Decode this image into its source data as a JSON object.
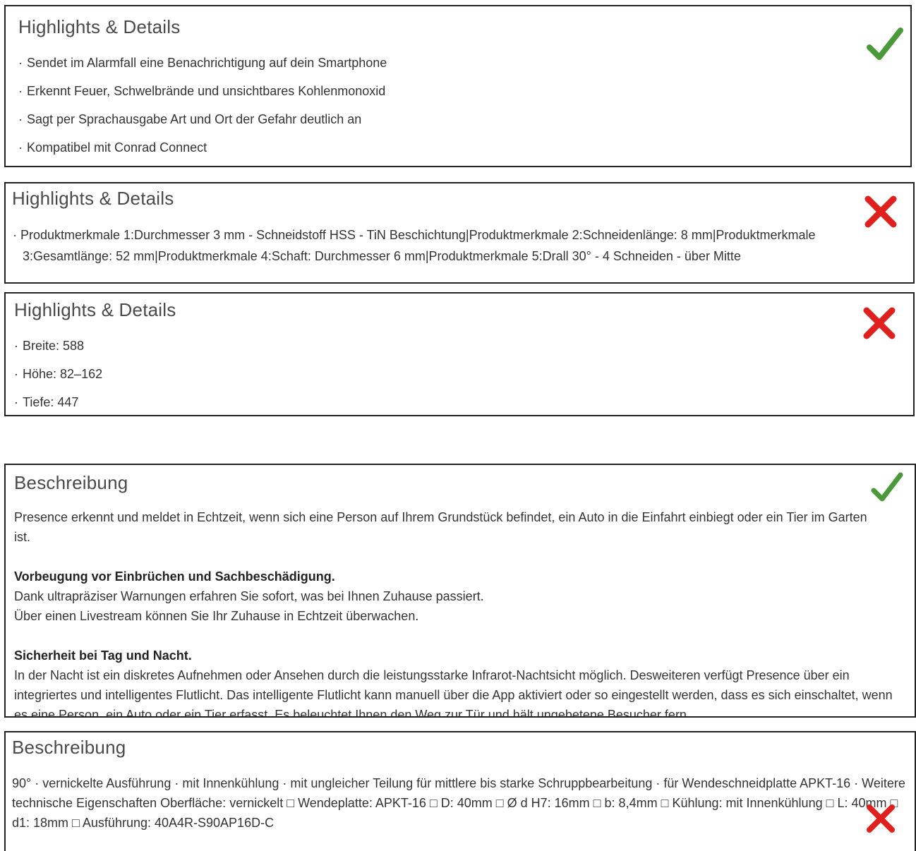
{
  "cards": [
    {
      "title": "Highlights & Details",
      "verdict": "check",
      "bullets": [
        "Sendet im Alarmfall eine Benachrichtigung auf dein Smartphone",
        "Erkennt Feuer, Schwelbrände und unsichtbares Kohlenmonoxid",
        "Sagt per Sprachausgabe Art und Ort der Gefahr deutlich an",
        "Kompatibel mit Conrad Connect"
      ]
    },
    {
      "title": "Highlights & Details",
      "verdict": "cross",
      "bullets": [
        "Produktmerkmale 1:Durchmesser 3 mm - Schneidstoff HSS - TiN Beschichtung|Produktmerkmale 2:Schneidenlänge: 8 mm|Produktmerkmale 3:Gesamtlänge: 52 mm|Produktmerkmale 4:Schaft: Durchmesser 6 mm|Produktmerkmale 5:Drall 30° - 4 Schneiden - über Mitte"
      ]
    },
    {
      "title": "Highlights & Details",
      "verdict": "cross",
      "bullets": [
        "Breite: 588",
        "Höhe: 82–162",
        "Tiefe: 447"
      ]
    },
    {
      "title": "Beschreibung",
      "verdict": "check",
      "intro": "Presence erkennt und meldet in Echtzeit, wenn sich eine Person auf Ihrem Grundstück befindet, ein Auto in die Einfahrt einbiegt oder ein Tier im Garten ist.",
      "section1_heading": "Vorbeugung vor Einbrüchen und Sachbeschädigung.",
      "section1_line1": "Dank ultrapräziser Warnungen erfahren Sie sofort, was bei Ihnen Zuhause passiert.",
      "section1_line2": "Über einen Livestream können Sie Ihr Zuhause in Echtzeit überwachen.",
      "section2_heading": "Sicherheit bei Tag und Nacht.",
      "section2_text": "In der Nacht ist ein diskretes Aufnehmen oder Ansehen durch die leistungsstarke Infrarot-Nachtsicht möglich. Desweiteren verfügt Presence über ein integriertes und intelligentes Flutlicht. Das intelligente Flutlicht kann manuell über die App aktiviert oder so eingestellt werden, dass es sich einschaltet, wenn es eine Person, ein Auto oder ein Tier erfasst. Es beleuchtet Ihnen den Weg zur Tür und hält ungebetene Besucher fern."
    },
    {
      "title": "Beschreibung",
      "verdict": "cross",
      "text": "90° · vernickelte Ausführung · mit Innenkühlung · mit ungleicher Teilung für mittlere bis starke Schruppbearbeitung · für Wendeschneidplatte APKT-16 · Weitere technische Eigenschaften Oberfläche: vernickelt □ Wendeplatte: APKT-16 □ D: 40mm □ Ø d H7: 16mm □ b: 8,4mm □ Kühlung: mit Innenkühlung □ L: 40mm □ d1: 18mm □ Ausführung: 40A4R-S90AP16D-C"
    }
  ],
  "colors": {
    "check": "#4a9a3a",
    "cross": "#e0201c",
    "border": "#222222"
  }
}
